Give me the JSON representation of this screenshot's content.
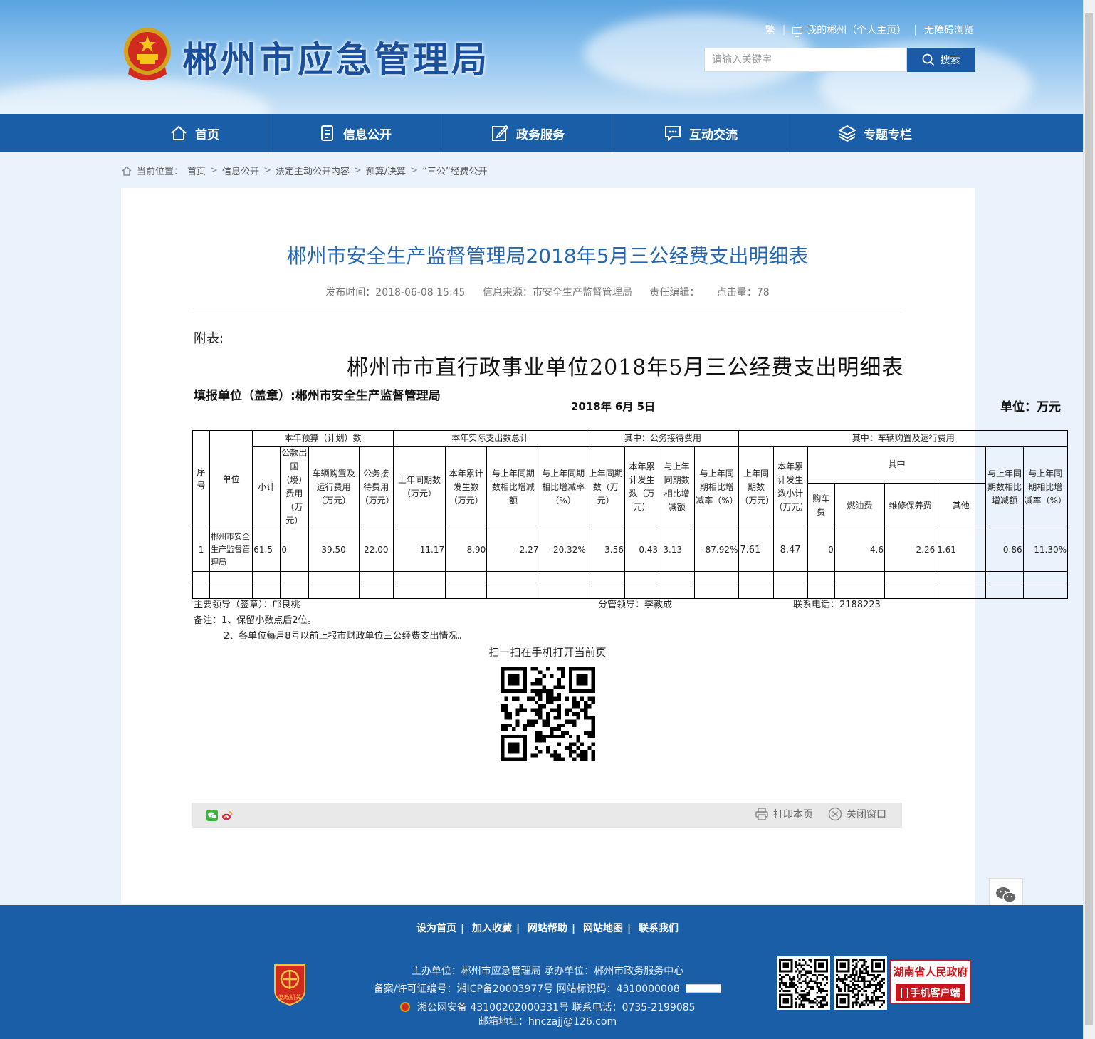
{
  "header": {
    "site_title": "郴州市应急管理局",
    "links": {
      "traditional": "繁",
      "my_chenzhou": "我的郴州（个人主页）",
      "accessible": "无障碍浏览"
    },
    "search": {
      "placeholder": "请输入关键字",
      "button": "搜索"
    }
  },
  "nav": [
    {
      "label": "首页",
      "icon": "home-icon"
    },
    {
      "label": "信息公开",
      "icon": "document-icon"
    },
    {
      "label": "政务服务",
      "icon": "edit-icon"
    },
    {
      "label": "互动交流",
      "icon": "chat-icon"
    },
    {
      "label": "专题专栏",
      "icon": "layers-icon"
    }
  ],
  "breadcrumb": {
    "prefix": "当前位置：",
    "items": [
      "首页",
      "信息公开",
      "法定主动公开内容",
      "预算/决算",
      "“三公”经费公开"
    ]
  },
  "article": {
    "title": "郴州市安全生产监督管理局2018年5月三公经费支出明细表",
    "publish_time": "发布时间：2018-06-08 15:45",
    "source": "信息来源：市安全生产监督管理局",
    "editor": "责任编辑：",
    "clicks": "点击量：78"
  },
  "attachment": {
    "label": "附表:",
    "table_title": "郴州市市直行政事业单位2018年5月三公经费支出明细表",
    "unit_name": "填报单位（盖章）:郴州市安全生产监督管理局",
    "report_date": "2018年  6月  5日",
    "unit_label": "单位：万元"
  },
  "fees_table": {
    "headers": {
      "seq": "序号",
      "unit": "单位",
      "budget_group": "本年预算（计划）数",
      "actual_group": "本年实际支出数总计",
      "reception_group": "其中：公务接待费用",
      "vehicle_group": "其中：车辆购置及运行费用",
      "subtotal": "小计",
      "abroad": "公款出国（境）费用（万元）",
      "vehicle_budget": "车辆购置及运行费用（万元）",
      "reception_budget": "公务接待费用（万元）",
      "last_year": "上年同期数（万元）",
      "cumulative": "本年累计发生数（万元）",
      "diff": "与上年同期数相比增减额",
      "rate": "与上年同期相比增减率（%）",
      "r_last": "上年同期数（万元）",
      "r_cum": "本年累计发生数（万元）",
      "r_diff": "与上年同期数相比增减额",
      "r_rate": "与上年同期相比增减率（%）",
      "v_last": "上年同期数（万元）",
      "v_cum": "本年累计发生数小计（万元）",
      "v_sub": "其中",
      "v_purchase": "购车费",
      "v_fuel": "燃油费",
      "v_repair": "维修保养费",
      "v_other": "其他",
      "v_diff": "与上年同期数相比增减额",
      "v_rate": "与上年同期相比增减率（%）"
    },
    "row": {
      "seq": "1",
      "unit": "郴州市安全生产监督管理局",
      "subtotal": "61.5",
      "abroad": "0",
      "vehicle_budget": "39.50",
      "reception_budget": "22.00",
      "last_year": "11.17",
      "cumulative": "8.90",
      "diff": "-2.27",
      "rate": "-20.32%",
      "r_last": "3.56",
      "r_cum": "0.43",
      "r_diff": "-3.13",
      "r_rate": "-87.92%",
      "v_last": "7.61",
      "v_cum": "8.47",
      "v_purchase": "0",
      "v_fuel": "4.6",
      "v_repair": "2.26",
      "v_other": "1.61",
      "v_diff": "0.86",
      "v_rate": "11.30%"
    }
  },
  "signatures": {
    "leader": "主要领导（签章）：邝良桃",
    "deputy": "分管领导：李教成",
    "phone": "联系电话：2188223"
  },
  "notes": {
    "n1": "备注：1、保留小数点后2位。",
    "n2": "2、各单位每月8号以前上报市财政单位三公经费支出情况。"
  },
  "qr_caption": "扫一扫在手机打开当前页",
  "sharebar": {
    "print": "打印本页",
    "close": "关闭窗口"
  },
  "footer": {
    "links": [
      "设为首页",
      "加入收藏",
      "网站帮助",
      "网站地图",
      "联系我们"
    ],
    "host": "主办单位：郴州市应急管理局   承办单位：郴州市政务服务中心",
    "icp": "备案/许可证编号：湘ICP备20003977号    网站标识码：4310000008",
    "police": "湘公网安备 43100202000331号    联系电话：0735-2199085",
    "email": "邮箱地址：hnczajj@126.com",
    "party_logo_text": "党政机关",
    "gov_badge": {
      "line1": "湖南省人民政府",
      "line2": "手机客户端"
    }
  },
  "colors": {
    "nav_blue": "#1a5ea8",
    "title_blue": "#2466b1",
    "badge_red": "#c8161d"
  }
}
